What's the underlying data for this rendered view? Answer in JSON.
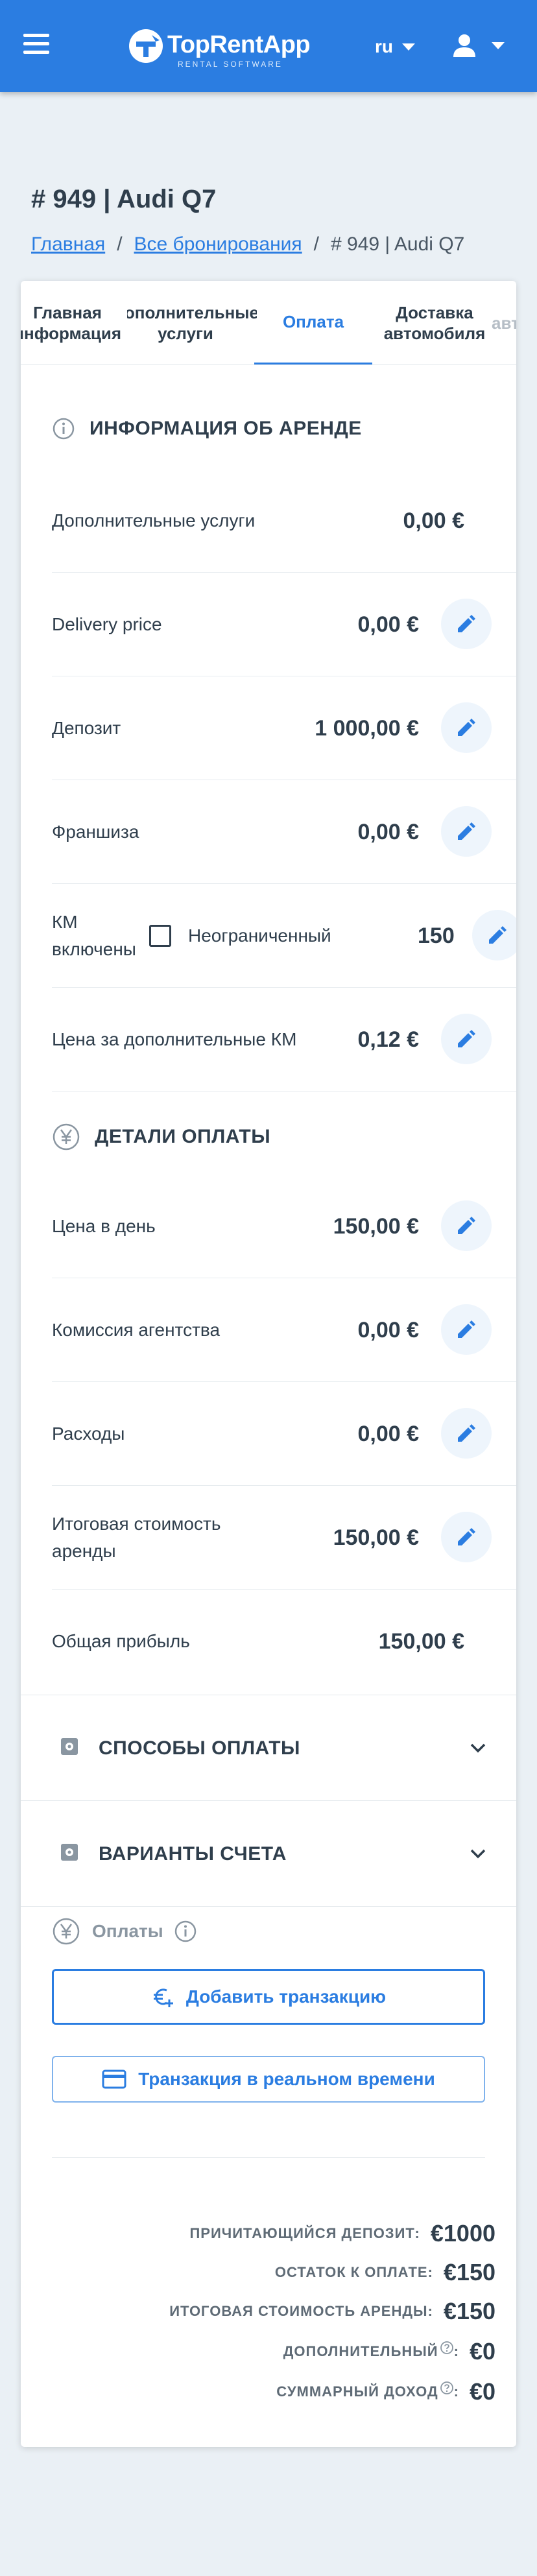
{
  "header": {
    "logo_name": "TopRentApp",
    "logo_sub": "RENTAL SOFTWARE",
    "language": "ru"
  },
  "page": {
    "title": "# 949 | Audi Q7",
    "breadcrumb": [
      "Главная",
      "Все бронирования",
      "# 949 | Audi Q7"
    ]
  },
  "tabs": [
    {
      "label": "Главная\nинформация"
    },
    {
      "label": "Дополнительные\nуслуги"
    },
    {
      "label": "Оплата"
    },
    {
      "label": "Доставка\nавтомобиля"
    },
    {
      "label": "авт"
    }
  ],
  "rental_info": {
    "title": "ИНФОРМАЦИЯ ОБ АРЕНДЕ",
    "rows": [
      {
        "label": "Дополнительные услуги",
        "value": "0,00 €"
      },
      {
        "label": "Delivery price",
        "value": "0,00 €"
      },
      {
        "label": "Депозит",
        "value": "1 000,00 €"
      },
      {
        "label": "Франшиза",
        "value": "0,00 €"
      },
      {
        "label": "КМ\nвключены",
        "checkbox_label": "Неограниченный",
        "checked": false,
        "value": "150"
      },
      {
        "label": "Цена за дополнительные КМ",
        "value": "0,12 €"
      }
    ]
  },
  "payment_details": {
    "title": "ДЕТАЛИ ОПЛАТЫ",
    "rows": [
      {
        "label": "Цена в день",
        "value": "150,00 €"
      },
      {
        "label": "Комиссия агентства",
        "value": "0,00 €"
      },
      {
        "label": "Расходы",
        "value": "0,00 €"
      },
      {
        "label": "Итоговая стоимость\nаренды",
        "value": "150,00 €"
      },
      {
        "label": "Общая прибыль",
        "value": "150,00 €"
      }
    ]
  },
  "sections": {
    "payment_methods": "СПОСОБЫ ОПЛАТЫ",
    "invoice_options": "ВАРИАНТЫ СЧЕТА"
  },
  "payments": {
    "title": "Оплаты",
    "add_transaction": "Добавить транзакцию",
    "realtime_transaction": "Транзакция в реальном времени"
  },
  "totals": [
    {
      "label": "ПРИЧИТАЮЩИЙСЯ ДЕПОЗИТ:",
      "value": "€1000",
      "info": false
    },
    {
      "label": "ОСТАТОК К ОПЛАТЕ:",
      "value": "€150",
      "info": false
    },
    {
      "label": "ИТОГОВАЯ СТОИМОСТЬ АРЕНДЫ:",
      "value": "€150",
      "info": false
    },
    {
      "label": "ДОПОЛНИТЕЛЬНЫЙ",
      "value": "€0",
      "info": true
    },
    {
      "label": "СУММАРНЫЙ ДОХОД",
      "value": "€0",
      "info": true
    }
  ],
  "colors": {
    "primary": "#2b7de1",
    "text": "#2f3e4c",
    "background": "#eaf0f5"
  }
}
